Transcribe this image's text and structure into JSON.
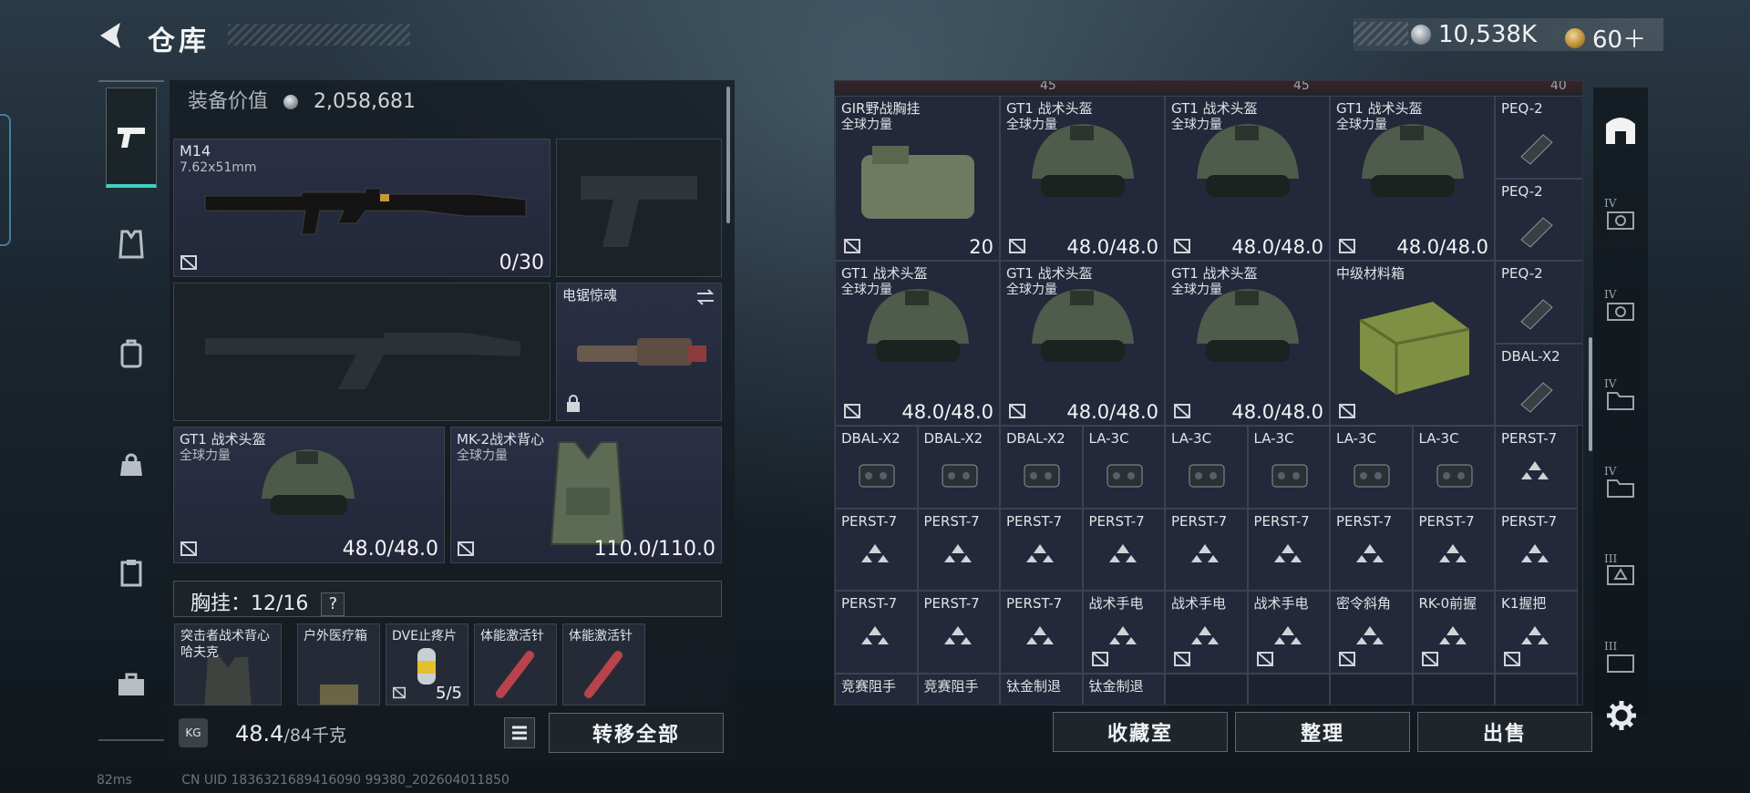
{
  "header": {
    "title": "仓库",
    "currencies": [
      {
        "icon": "silver-coin-icon",
        "value": "10,538K"
      },
      {
        "icon": "gold-coin-icon",
        "value": "60＋"
      }
    ]
  },
  "left_rail": [
    "pistol-icon",
    "vest-icon",
    "backpack-icon",
    "bag-icon",
    "clipboard-icon",
    "toolbox-icon"
  ],
  "equipment": {
    "value_label": "装备价值",
    "value": "2,058,681",
    "primary": {
      "name": "M14",
      "caliber": "7.62x51mm",
      "ammo": "0/30"
    },
    "melee": {
      "name": "电锯惊魂"
    },
    "helmet": {
      "name": "GT1 战术头盔",
      "faction": "全球力量",
      "durability": "48.0/48.0"
    },
    "armor": {
      "name": "MK-2战术背心",
      "faction": "全球力量",
      "durability": "110.0/110.0"
    },
    "rig": {
      "label": "胸挂：",
      "capacity": "12/16",
      "help": "?"
    },
    "rig_items": [
      {
        "name": "突击者战术背心",
        "sub": "哈夫克",
        "count": ""
      },
      {
        "name": "户外医疗箱",
        "sub": "",
        "count": ""
      },
      {
        "name": "DVE止疼片",
        "sub": "",
        "count": "5/5"
      },
      {
        "name": "体能激活针",
        "sub": "",
        "count": ""
      },
      {
        "name": "体能激活针",
        "sub": "",
        "count": ""
      }
    ]
  },
  "weight": {
    "current": "48.4",
    "max": "/84千克",
    "icon_text": "KG"
  },
  "transfer_all": "转移全部",
  "stash": {
    "top_counts": [
      "45",
      "45",
      "40"
    ],
    "row1": [
      {
        "name": "GIR野战胸挂",
        "sub": "全球力量",
        "value": "20"
      },
      {
        "name": "GT1 战术头盔",
        "sub": "全球力量",
        "value": "48.0/48.0"
      },
      {
        "name": "GT1 战术头盔",
        "sub": "全球力量",
        "value": "48.0/48.0"
      },
      {
        "name": "GT1 战术头盔",
        "sub": "全球力量",
        "value": "48.0/48.0"
      }
    ],
    "row2": [
      {
        "name": "GT1 战术头盔",
        "sub": "全球力量",
        "value": "48.0/48.0"
      },
      {
        "name": "GT1 战术头盔",
        "sub": "全球力量",
        "value": "48.0/48.0"
      },
      {
        "name": "GT1 战术头盔",
        "sub": "全球力量",
        "value": "48.0/48.0"
      },
      {
        "name": "中级材料箱",
        "sub": "",
        "value": ""
      }
    ],
    "side_column": [
      "PEQ-2",
      "PEQ-2",
      "PEQ-2",
      "DBAL-X2"
    ],
    "small_rows": [
      [
        "DBAL-X2",
        "DBAL-X2",
        "DBAL-X2",
        "LA-3C",
        "LA-3C",
        "LA-3C",
        "LA-3C",
        "LA-3C",
        "PERST-7"
      ],
      [
        "PERST-7",
        "PERST-7",
        "PERST-7",
        "PERST-7",
        "PERST-7",
        "PERST-7",
        "PERST-7",
        "PERST-7",
        "PERST-7"
      ],
      [
        "PERST-7",
        "PERST-7",
        "PERST-7",
        "战术手电",
        "战术手电",
        "战术手电",
        "密令斜角",
        "RK-0前握",
        "K1握把"
      ],
      [
        "竞赛阻手",
        "竞赛阻手",
        "钛金制退",
        "钛金制退",
        "",
        "",
        "",
        "",
        ""
      ]
    ]
  },
  "buttons": {
    "collection": "收藏室",
    "organize": "整理",
    "sell": "出售"
  },
  "right_rail": [
    {
      "roman": "",
      "icon": "vault-icon"
    },
    {
      "roman": "IV",
      "icon": "case-icon"
    },
    {
      "roman": "IV",
      "icon": "case-icon"
    },
    {
      "roman": "IV",
      "icon": "case-icon"
    },
    {
      "roman": "IV",
      "icon": "case-icon"
    },
    {
      "roman": "III",
      "icon": "case-icon"
    },
    {
      "roman": "III",
      "icon": "case-icon"
    }
  ],
  "footer": {
    "ping": "82ms",
    "uid": "CN UID 1836321689416090 99380_202604011850"
  },
  "colors": {
    "accent": "#3fd2c0",
    "slot_bg": "#23283a",
    "panel": "#171d26"
  }
}
